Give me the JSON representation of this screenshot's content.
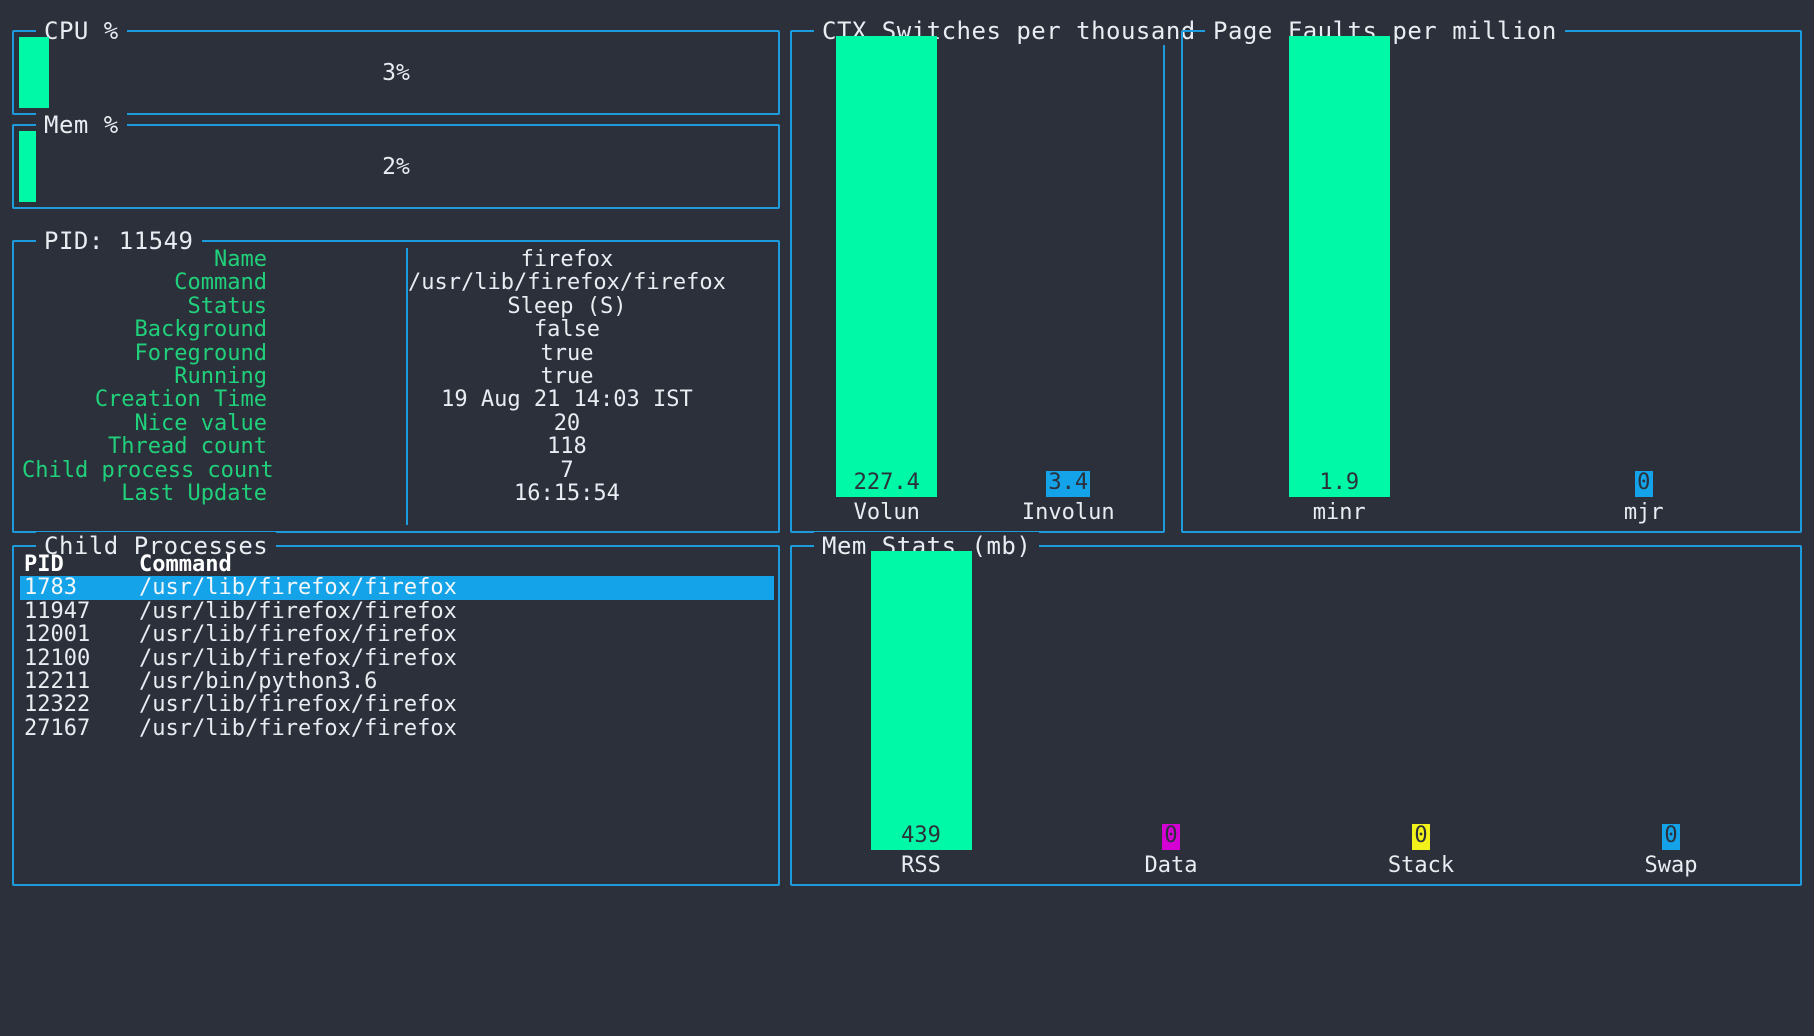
{
  "theme": {
    "bg": "#2b303b",
    "border": "#1e9bdd",
    "bar": "#00f9a6",
    "label": "#21d07a",
    "text": "#e8edf2",
    "select": "#14a3e8",
    "magenta": "#d400d4",
    "yellow": "#f2f21a",
    "cyan": "#14a3e8"
  },
  "cpu": {
    "title": "CPU %",
    "percent_label": "3%",
    "percent": 3
  },
  "mem": {
    "title": "Mem %",
    "percent_label": "2%",
    "percent": 2
  },
  "pid_panel": {
    "title": "PID: 11549",
    "rows": [
      {
        "label": "Name",
        "value": "firefox"
      },
      {
        "label": "Command",
        "value": "/usr/lib/firefox/firefox"
      },
      {
        "label": "Status",
        "value": "Sleep (S)"
      },
      {
        "label": "Background",
        "value": "false"
      },
      {
        "label": "Foreground",
        "value": "true"
      },
      {
        "label": "Running",
        "value": "true"
      },
      {
        "label": "Creation Time",
        "value": "19 Aug 21 14:03 IST"
      },
      {
        "label": "Nice value",
        "value": "20"
      },
      {
        "label": "Thread count",
        "value": "118"
      },
      {
        "label": "Child process count",
        "value": "7"
      },
      {
        "label": "Last Update",
        "value": "16:15:54"
      }
    ]
  },
  "child_processes": {
    "title": "Child Processes",
    "columns": {
      "pid": "PID",
      "command": "Command"
    },
    "rows": [
      {
        "pid": "1783",
        "command": "/usr/lib/firefox/firefox",
        "selected": true
      },
      {
        "pid": "11947",
        "command": "/usr/lib/firefox/firefox",
        "selected": false
      },
      {
        "pid": "12001",
        "command": "/usr/lib/firefox/firefox",
        "selected": false
      },
      {
        "pid": "12100",
        "command": "/usr/lib/firefox/firefox",
        "selected": false
      },
      {
        "pid": "12211",
        "command": "/usr/bin/python3.6",
        "selected": false
      },
      {
        "pid": "12322",
        "command": "/usr/lib/firefox/firefox",
        "selected": false
      },
      {
        "pid": "27167",
        "command": "/usr/lib/firefox/firefox",
        "selected": false
      }
    ]
  },
  "ctx_switches": {
    "title": "CTX Switches per thousand"
  },
  "page_faults": {
    "title": "Page Faults per million"
  },
  "mem_stats": {
    "title": "Mem Stats (mb)"
  },
  "chart_data": [
    {
      "type": "bar",
      "title": "CTX Switches per thousand",
      "categories": [
        "Volun",
        "Involun"
      ],
      "values": [
        227.4,
        3.4
      ],
      "value_labels": [
        "227.4",
        "3.4"
      ],
      "bar_colors": [
        "#00f9a6",
        "#14a3e8"
      ],
      "ylim": [
        0,
        227.4
      ],
      "xlabel": "",
      "ylabel": "",
      "grid": false,
      "legend": "none"
    },
    {
      "type": "bar",
      "title": "Page Faults per million",
      "categories": [
        "minr",
        "mjr"
      ],
      "values": [
        1.9,
        0
      ],
      "value_labels": [
        "1.9",
        "0"
      ],
      "bar_colors": [
        "#00f9a6",
        "#14a3e8"
      ],
      "ylim": [
        0,
        1.9
      ],
      "xlabel": "",
      "ylabel": "",
      "grid": false,
      "legend": "none"
    },
    {
      "type": "bar",
      "title": "Mem Stats (mb)",
      "categories": [
        "RSS",
        "Data",
        "Stack",
        "Swap"
      ],
      "values": [
        439,
        0,
        0,
        0
      ],
      "value_labels": [
        "439",
        "0",
        "0",
        "0"
      ],
      "bar_colors": [
        "#00f9a6",
        "#d400d4",
        "#f2f21a",
        "#14a3e8"
      ],
      "ylim": [
        0,
        439
      ],
      "xlabel": "",
      "ylabel": "",
      "grid": false,
      "legend": "none"
    }
  ]
}
